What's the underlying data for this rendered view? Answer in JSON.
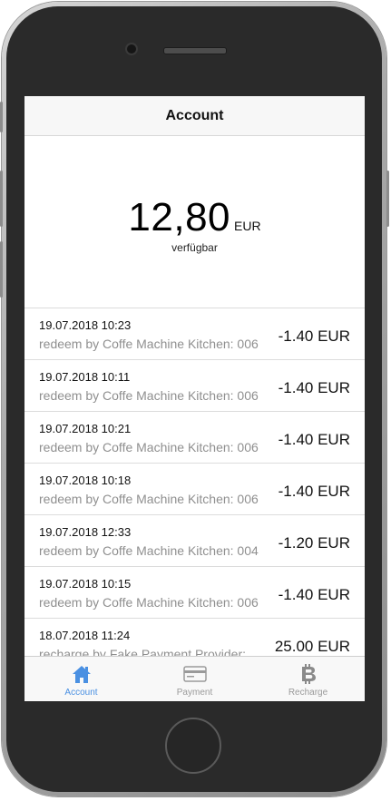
{
  "nav": {
    "title": "Account"
  },
  "balance": {
    "amount": "12,80",
    "currency": "EUR",
    "label": "verfügbar"
  },
  "transactions": [
    {
      "date": "19.07.2018 10:23",
      "desc": "redeem by Coffe Machine Kitchen: 006",
      "amount": "-1.40 EUR"
    },
    {
      "date": "19.07.2018 10:11",
      "desc": "redeem by Coffe Machine Kitchen: 006",
      "amount": "-1.40 EUR"
    },
    {
      "date": "19.07.2018 10:21",
      "desc": "redeem by Coffe Machine Kitchen: 006",
      "amount": "-1.40 EUR"
    },
    {
      "date": "19.07.2018 10:18",
      "desc": "redeem by Coffe Machine Kitchen: 006",
      "amount": "-1.40 EUR"
    },
    {
      "date": "19.07.2018 12:33",
      "desc": "redeem by Coffe Machine Kitchen: 004",
      "amount": "-1.20 EUR"
    },
    {
      "date": "19.07.2018 10:15",
      "desc": "redeem by Coffe Machine Kitchen: 006",
      "amount": "-1.40 EUR"
    },
    {
      "date": "18.07.2018 11:24",
      "desc": "recharge by Fake Payment Provider:",
      "amount": "25.00 EUR"
    }
  ],
  "tabs": [
    {
      "label": "Account",
      "icon": "home-icon",
      "active": true
    },
    {
      "label": "Payment",
      "icon": "card-icon",
      "active": false
    },
    {
      "label": "Recharge",
      "icon": "bitcoin-icon",
      "active": false
    }
  ],
  "colors": {
    "accent": "#4a90e2",
    "inactive": "#9a9a9a"
  }
}
